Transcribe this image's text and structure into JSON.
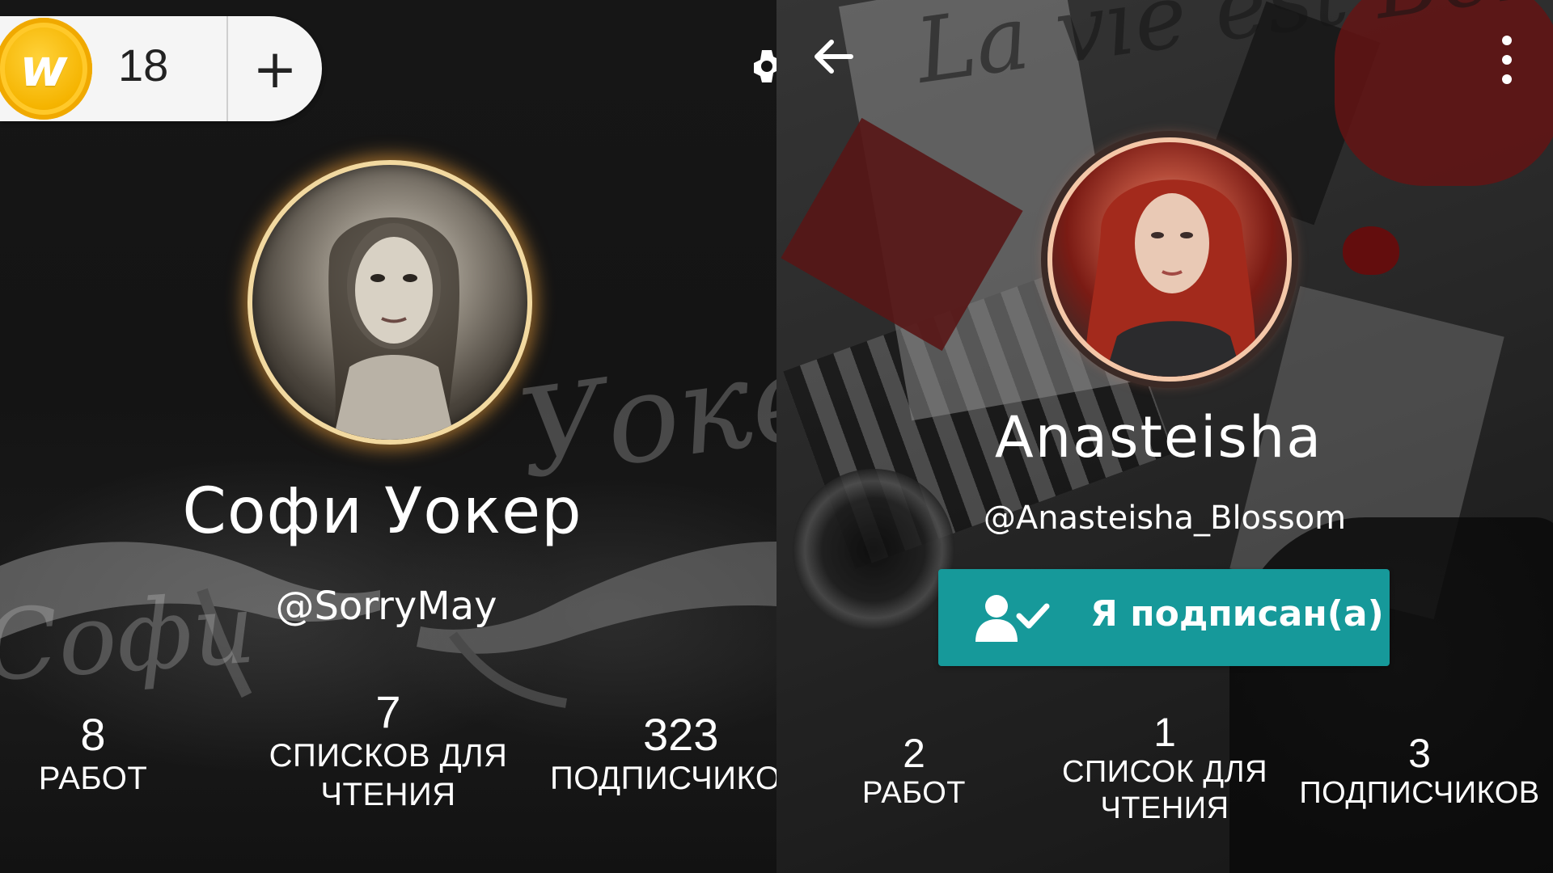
{
  "left_profile": {
    "coins": {
      "count": "18",
      "logo_letter": "w",
      "add_label": "+"
    },
    "decorative_script": {
      "surname": "Уокер",
      "firstname": "Софи"
    },
    "name": "Софи Уокер",
    "handle": "@SorryMay",
    "stats": [
      {
        "value": "8",
        "label": "РАБОТ"
      },
      {
        "value": "7",
        "label_line1": "СПИСКОВ ДЛЯ",
        "label_line2": "ЧТЕНИЯ"
      },
      {
        "value": "323",
        "label": "ПОДПИСЧИКОВ"
      }
    ]
  },
  "right_profile": {
    "decorative_script": "La vie est Bel",
    "name": "Anasteisha",
    "handle": "@Anasteisha_Blossom",
    "follow_button": {
      "label": "Я подписан(а)",
      "color": "#16999a"
    },
    "stats": [
      {
        "value": "2",
        "label": "РАБОТ"
      },
      {
        "value": "1",
        "label_line1": "СПИСОК ДЛЯ",
        "label_line2": "ЧТЕНИЯ"
      },
      {
        "value": "3",
        "label": "ПОДПИСЧИКОВ"
      }
    ]
  },
  "icons": {
    "coin": "wattpad-coin-icon",
    "add": "plus-icon",
    "settings": "gear-icon",
    "back": "arrow-left-icon",
    "more": "more-vertical-icon",
    "follow": "user-check-icon"
  },
  "colors": {
    "coin_gold": "#f5b400",
    "follow_teal": "#16999a",
    "avatar_glow_left": "#f2d9a0",
    "avatar_ring_right": "#f4c7a8"
  }
}
